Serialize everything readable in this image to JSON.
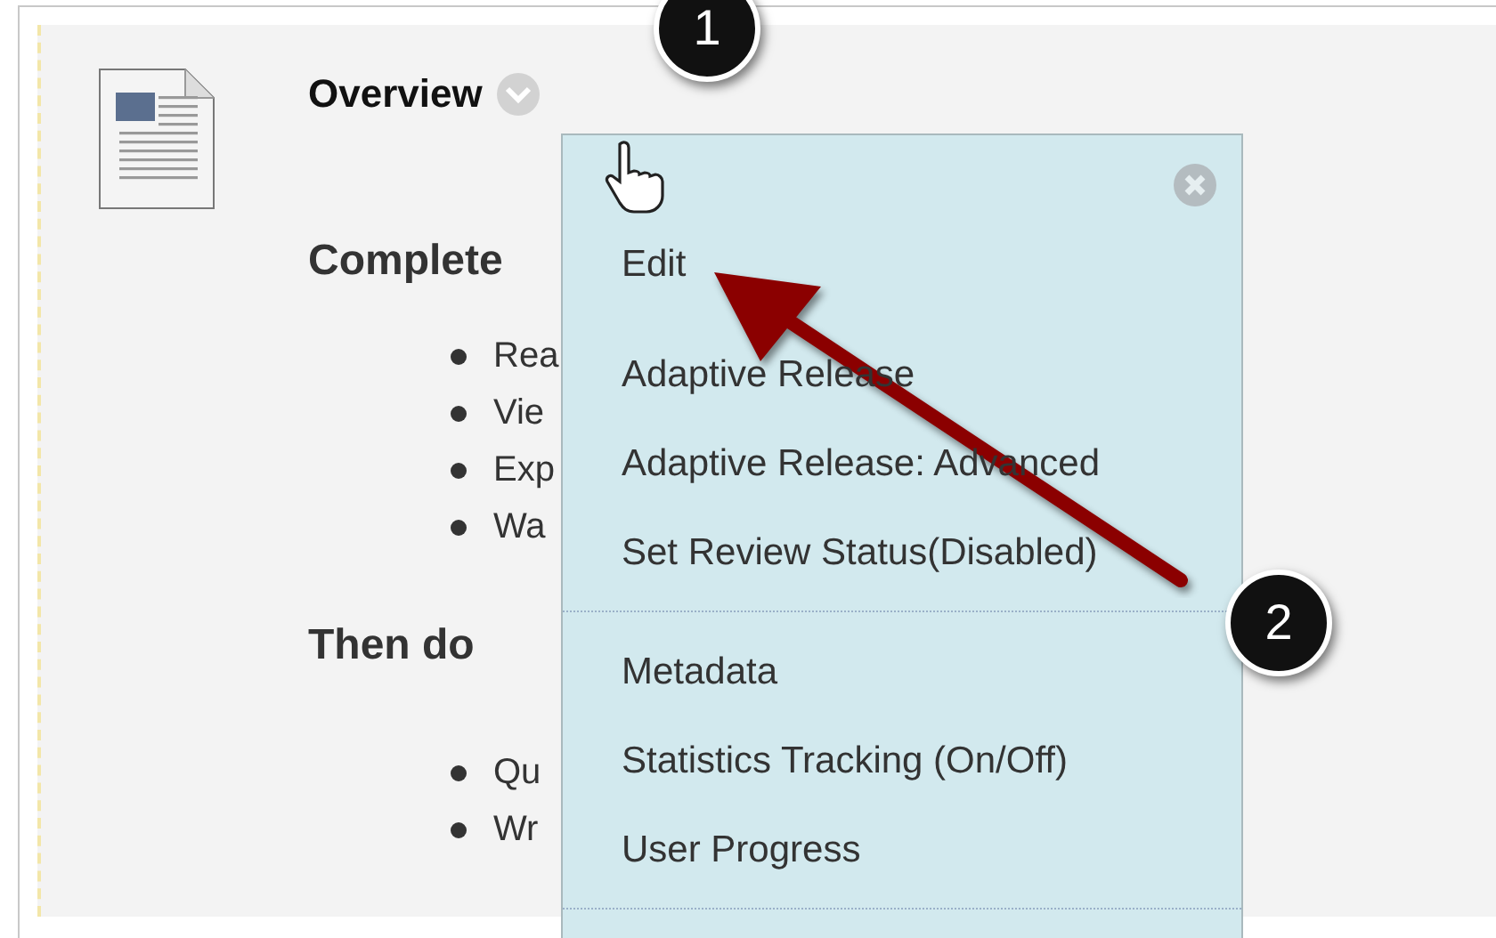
{
  "item": {
    "title": "Overview",
    "sections": [
      {
        "heading": "Complete",
        "bullets": [
          "Rea",
          "Vie",
          "Exp",
          "Wa"
        ]
      },
      {
        "heading": "Then do",
        "bullets": [
          "Qu",
          "Wr"
        ]
      }
    ]
  },
  "menu": {
    "groups": [
      [
        "Edit",
        "Adaptive Release",
        "Adaptive Release: Advanced",
        "Set Review Status(Disabled)"
      ],
      [
        "Metadata",
        "Statistics Tracking (On/Off)",
        "User Progress"
      ]
    ]
  },
  "callouts": [
    "1",
    "2"
  ]
}
